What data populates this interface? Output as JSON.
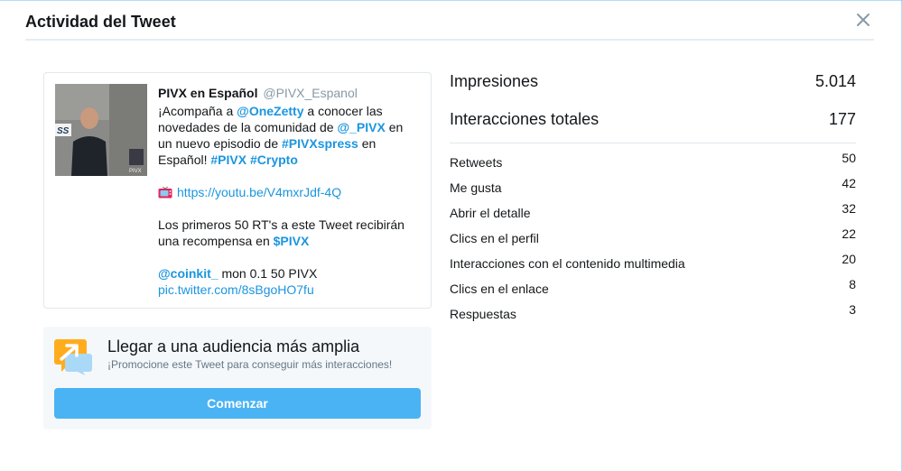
{
  "modal": {
    "title": "Actividad del Tweet",
    "close_icon": "close-icon"
  },
  "tweet": {
    "author_name": "PIVX en Español",
    "author_handle": "@PIVX_Espanol",
    "media_icon": "video-thumbnail",
    "line1_pre": "¡Acompaña a ",
    "mention1": "@OneZetty",
    "line1_post": " a conocer las",
    "line2_pre": "novedades de la comunidad de ",
    "mention2": "@_PIVX",
    "line2_post": " en",
    "line3_pre": "un nuevo episodio de ",
    "hashtag1": "#PIVXspress",
    "line3_post": " en",
    "line4_pre": "Español! ",
    "hashtag2": "#PIVX",
    "hashtag3": "#Crypto",
    "tv_icon": "television-icon",
    "youtube_link": "https://youtu.be/V4mxrJdf-4Q",
    "line5": "Los primeros 50 RT's a este Tweet recibirán",
    "line6_pre": "una recompensa en ",
    "cashtag": "$PIVX",
    "mention3": "@coinkit_",
    "line7_post": " mon 0.1 50 PIVX",
    "pic_link": "pic.twitter.com/8sBgoHO7fu"
  },
  "promote": {
    "icon": "promote-arrow-icon",
    "title": "Llegar a una audiencia más amplia",
    "subtitle": "¡Promocione este Tweet para conseguir más interacciones!",
    "button_label": "Comenzar"
  },
  "metrics": {
    "impressions_label": "Impresiones",
    "impressions_value": "5.014",
    "total_label": "Interacciones totales",
    "total_value": "177",
    "rows": [
      {
        "label": "Retweets",
        "value": "50"
      },
      {
        "label": "Me gusta",
        "value": "42"
      },
      {
        "label": "Abrir el detalle",
        "value": "32"
      },
      {
        "label": "Clics en el perfil",
        "value": "22"
      },
      {
        "label": "Interacciones con el contenido multimedia",
        "value": "20"
      },
      {
        "label": "Clics en el enlace",
        "value": "8"
      },
      {
        "label": "Respuestas",
        "value": "3"
      }
    ]
  },
  "colors": {
    "link": "#1b95e0",
    "button": "#4ab3f4",
    "panel": "#f5f8fa",
    "muted": "#657786"
  }
}
